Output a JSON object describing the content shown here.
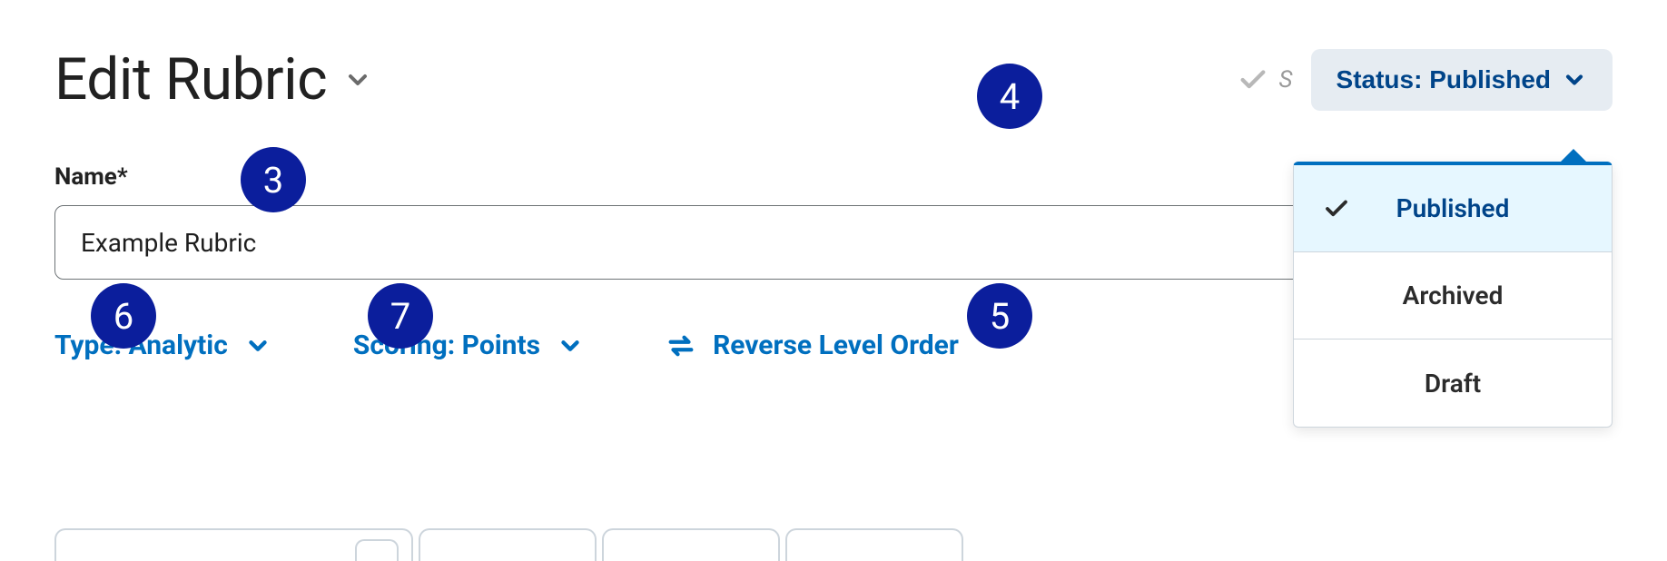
{
  "header": {
    "title": "Edit Rubric",
    "save_state_prefix": "S",
    "status_label": "Status: Published"
  },
  "status_menu": {
    "items": [
      {
        "label": "Published",
        "selected": true
      },
      {
        "label": "Archived",
        "selected": false
      },
      {
        "label": "Draft",
        "selected": false
      }
    ]
  },
  "name_field": {
    "label": "Name*",
    "value": "Example Rubric"
  },
  "options": {
    "type_label": "Type: Analytic",
    "scoring_label": "Scoring: Points",
    "reverse_label": "Reverse Level Order"
  },
  "annotations": {
    "a3": "3",
    "a4": "4",
    "a5": "5",
    "a6": "6",
    "a7": "7"
  }
}
